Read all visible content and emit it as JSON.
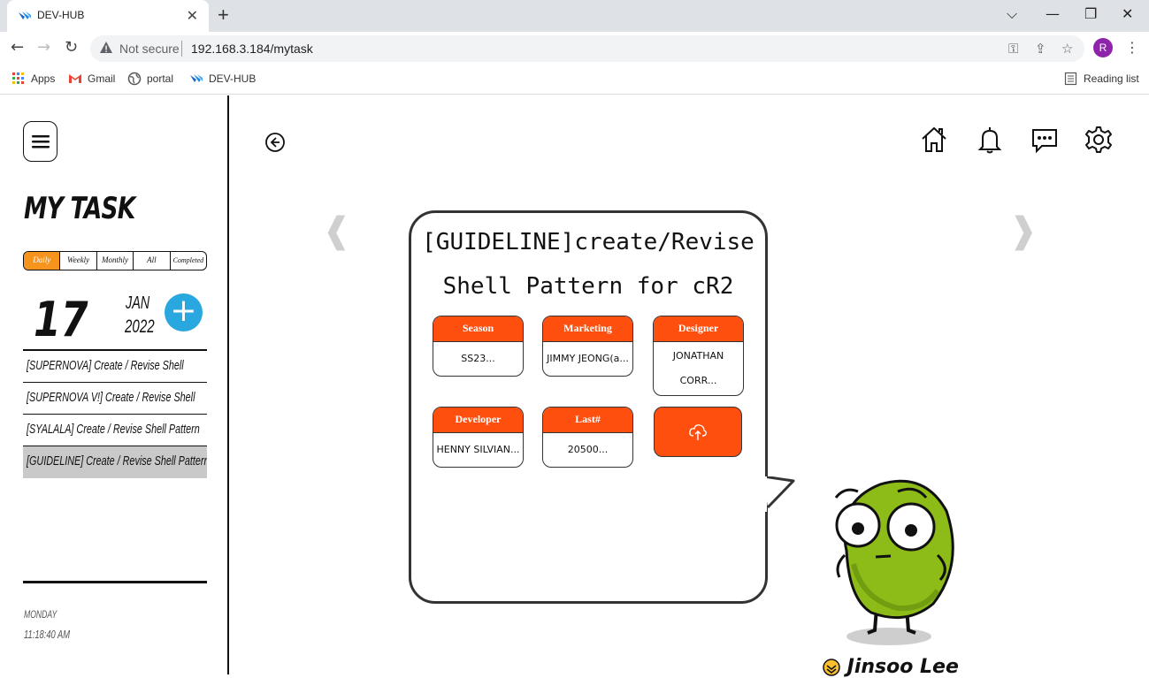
{
  "browser": {
    "tab_title": "DEV-HUB",
    "new_tab": "+",
    "security_label": "Not secure",
    "url": "192.168.3.184/mytask",
    "profile_initial": "R",
    "bookmarks": [
      {
        "label": "Apps",
        "icon": "apps-grid-icon"
      },
      {
        "label": "Gmail",
        "icon": "gmail-icon"
      },
      {
        "label": "portal",
        "icon": "globe-icon"
      },
      {
        "label": "DEV-HUB",
        "icon": "devhub-icon"
      }
    ],
    "reading_list": "Reading list"
  },
  "sidebar": {
    "title": "MY TASK",
    "filters": [
      "Daily",
      "Weekly",
      "Monthly",
      "All",
      "Completed"
    ],
    "active_filter": "Daily",
    "date": {
      "day": "17",
      "month": "JAN",
      "year": "2022"
    },
    "add_label": "+",
    "tasks": [
      "[SUPERNOVA] Create / Revise Shell",
      "[SUPERNOVA V!] Create / Revise Shell",
      "[SYALALA] Create / Revise Shell Pattern",
      "[GUIDELINE] Create / Revise Shell Pattern"
    ],
    "selected_task_index": 3,
    "weekday": "MONDAY",
    "time": "11:18:40 AM"
  },
  "detail": {
    "title_line1": "[GUIDELINE]create/Revise",
    "title_line2": "Shell Pattern for cR2",
    "fields": [
      {
        "label": "Season",
        "value": "SS23..."
      },
      {
        "label": "Marketing",
        "value": "JIMMY JEONG(a..."
      },
      {
        "label": "Designer",
        "value": "JONATHAN CORR..."
      },
      {
        "label": "Developer",
        "value": "HENNY SILVIAN..."
      },
      {
        "label": "Last#",
        "value": "20500..."
      }
    ],
    "prev_arrow": "❰",
    "next_arrow": "❱"
  },
  "user": {
    "name": "Jinsoo Lee"
  },
  "colors": {
    "accent_orange": "#ff4f0f",
    "filter_active": "#f7941d",
    "add_blue": "#29a8e0"
  }
}
